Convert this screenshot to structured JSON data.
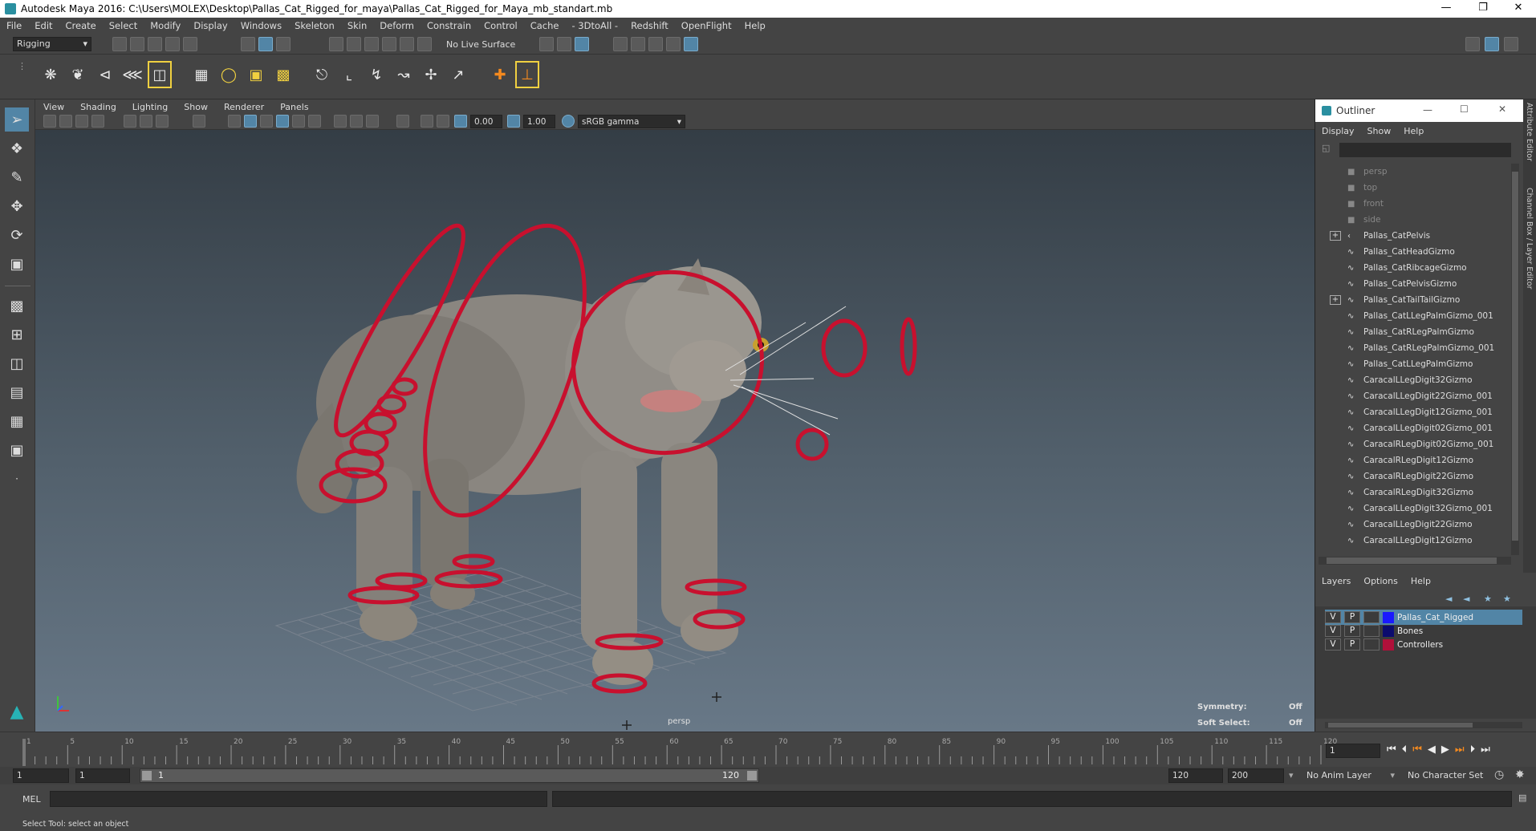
{
  "window": {
    "title": "Autodesk Maya 2016: C:\\Users\\MOLEX\\Desktop\\Pallas_Cat_Rigged_for_maya\\Pallas_Cat_Rigged_for_Maya_mb_standart.mb"
  },
  "menubar": [
    "File",
    "Edit",
    "Create",
    "Select",
    "Modify",
    "Display",
    "Windows",
    "Skeleton",
    "Skin",
    "Deform",
    "Constrain",
    "Control",
    "Cache",
    "- 3DtoAll -",
    "Redshift",
    "OpenFlight",
    "Help"
  ],
  "status": {
    "menuset": "Rigging",
    "live_surface": "No Live Surface"
  },
  "viewport": {
    "menu": [
      "View",
      "Shading",
      "Lighting",
      "Show",
      "Renderer",
      "Panels"
    ],
    "exposure": "0.00",
    "gamma": "1.00",
    "color_space": "sRGB gamma",
    "camera_label": "persp",
    "symmetry_label": "Symmetry:",
    "symmetry_value": "Off",
    "soft_select_label": "Soft Select:",
    "soft_select_value": "Off"
  },
  "outliner": {
    "title": "Outliner",
    "menu": [
      "Display",
      "Show",
      "Help"
    ],
    "items": [
      {
        "name": "persp",
        "dim": true,
        "icon": "camera-icon"
      },
      {
        "name": "top",
        "dim": true,
        "icon": "camera-icon"
      },
      {
        "name": "front",
        "dim": true,
        "icon": "camera-icon"
      },
      {
        "name": "side",
        "dim": true,
        "icon": "camera-icon"
      },
      {
        "name": "Pallas_CatPelvis",
        "expand": true,
        "icon": "joint-icon"
      },
      {
        "name": "Pallas_CatHeadGizmo",
        "icon": "curve-icon"
      },
      {
        "name": "Pallas_CatRibcageGizmo",
        "icon": "curve-icon"
      },
      {
        "name": "Pallas_CatPelvisGizmo",
        "icon": "curve-icon"
      },
      {
        "name": "Pallas_CatTailTailGizmo",
        "expand": true,
        "icon": "curve-icon"
      },
      {
        "name": "Pallas_CatLLegPalmGizmo_001",
        "icon": "curve-icon"
      },
      {
        "name": "Pallas_CatRLegPalmGizmo",
        "icon": "curve-icon"
      },
      {
        "name": "Pallas_CatRLegPalmGizmo_001",
        "icon": "curve-icon"
      },
      {
        "name": "Pallas_CatLLegPalmGizmo",
        "icon": "curve-icon"
      },
      {
        "name": "CaracalLLegDigit32Gizmo",
        "icon": "curve-icon"
      },
      {
        "name": "CaracalLLegDigit22Gizmo_001",
        "icon": "curve-icon"
      },
      {
        "name": "CaracalLLegDigit12Gizmo_001",
        "icon": "curve-icon"
      },
      {
        "name": "CaracalLLegDigit02Gizmo_001",
        "icon": "curve-icon"
      },
      {
        "name": "CaracalRLegDigit02Gizmo_001",
        "icon": "curve-icon"
      },
      {
        "name": "CaracalRLegDigit12Gizmo",
        "icon": "curve-icon"
      },
      {
        "name": "CaracalRLegDigit22Gizmo",
        "icon": "curve-icon"
      },
      {
        "name": "CaracalRLegDigit32Gizmo",
        "icon": "curve-icon"
      },
      {
        "name": "CaracalLLegDigit32Gizmo_001",
        "icon": "curve-icon"
      },
      {
        "name": "CaracalLLegDigit22Gizmo",
        "icon": "curve-icon"
      },
      {
        "name": "CaracalLLegDigit12Gizmo",
        "icon": "curve-icon"
      }
    ]
  },
  "layers": {
    "menu": [
      "Layers",
      "Options",
      "Help"
    ],
    "rows": [
      {
        "v": "V",
        "p": "P",
        "name": "Pallas_Cat_Rigged",
        "color": "#1a1aff",
        "selected": true
      },
      {
        "v": "V",
        "p": "P",
        "name": "Bones",
        "color": "#0b0b6e",
        "selected": false
      },
      {
        "v": "V",
        "p": "P",
        "name": "Controllers",
        "color": "#b0103a",
        "selected": false
      }
    ]
  },
  "right_strip": {
    "attr": "Attribute Editor",
    "channel": "Channel Box / Layer Editor"
  },
  "timeline": {
    "ticks": [
      "1",
      "5",
      "10",
      "15",
      "20",
      "25",
      "30",
      "35",
      "40",
      "45",
      "50",
      "55",
      "60",
      "65",
      "70",
      "75",
      "80",
      "85",
      "90",
      "95",
      "100",
      "105",
      "110",
      "115",
      "120"
    ],
    "current_frame": "1"
  },
  "range": {
    "start": "1",
    "playback_start": "1",
    "slider_start": "1",
    "slider_end": "120",
    "playback_end": "120",
    "end": "200",
    "anim_layer": "No Anim Layer",
    "char_set": "No Character Set"
  },
  "cmd": {
    "label": "MEL"
  },
  "help": {
    "text": "Select Tool: select an object"
  },
  "colors": {
    "accent": "#5285a6",
    "rig_red": "#c8102e"
  }
}
